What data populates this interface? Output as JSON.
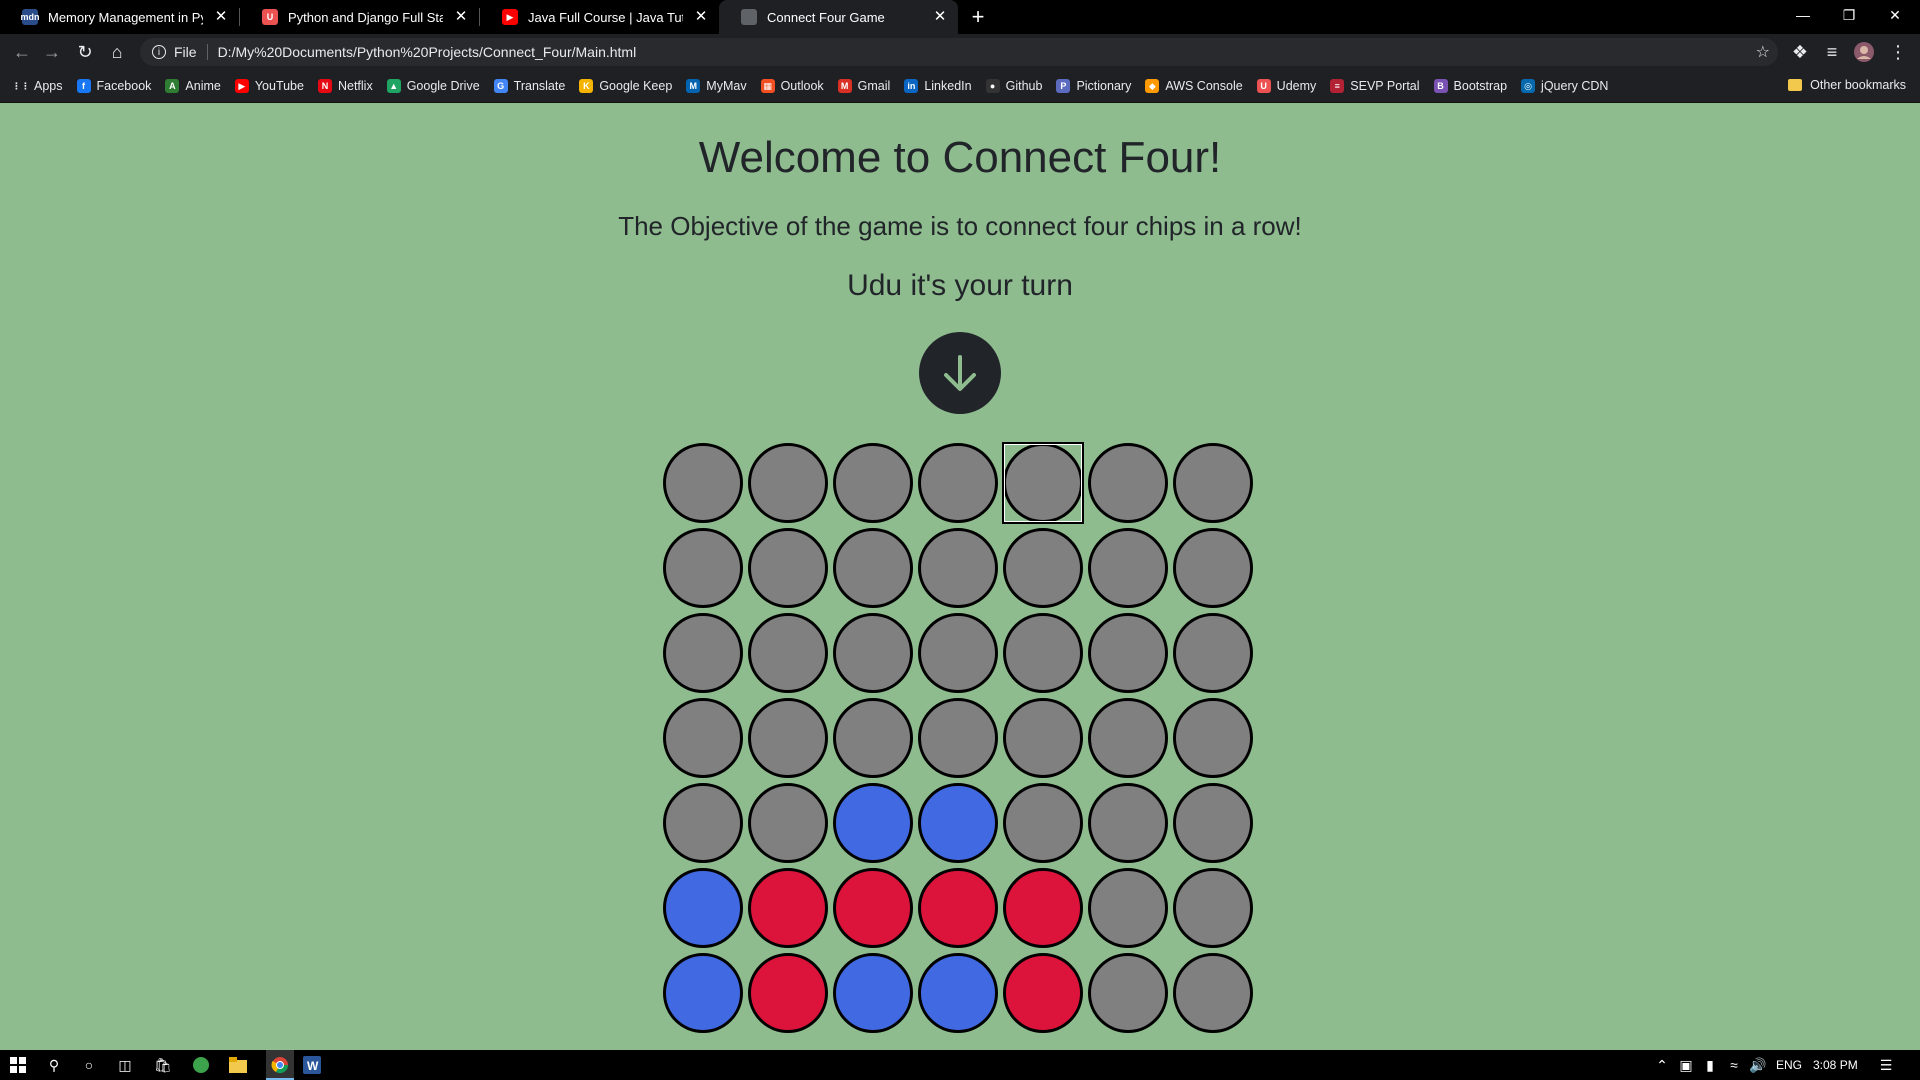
{
  "browser": {
    "tabs": [
      {
        "title": "Memory Management in Python",
        "favicon": "mdn-icon",
        "color": "#2a4c8a",
        "glyph": "mdn",
        "active": false
      },
      {
        "title": "Python and Django Full Stack We",
        "favicon": "udemy-icon",
        "color": "#ec5252",
        "glyph": "U",
        "active": false
      },
      {
        "title": "Java Full Course | Java Tutorial fo",
        "favicon": "youtube-icon",
        "color": "#ff0000",
        "glyph": "▶",
        "active": false
      },
      {
        "title": "Connect Four Game",
        "favicon": "globe-icon",
        "color": "#5f6368",
        "glyph": "",
        "active": true
      }
    ],
    "address": {
      "scheme": "File",
      "url": "D:/My%20Documents/Python%20Projects/Connect_Four/Main.html"
    },
    "bookmarks": [
      {
        "label": "Apps",
        "icon": "apps-grid-icon",
        "color": "#e8eaed",
        "glyph": "⋮⋮"
      },
      {
        "label": "Facebook",
        "icon": "facebook-icon",
        "color": "#1877f2",
        "glyph": "f"
      },
      {
        "label": "Anime",
        "icon": "anime-icon",
        "color": "#2e7d32",
        "glyph": "A"
      },
      {
        "label": "YouTube",
        "icon": "youtube-icon",
        "color": "#ff0000",
        "glyph": "▶"
      },
      {
        "label": "Netflix",
        "icon": "netflix-icon",
        "color": "#e50914",
        "glyph": "N"
      },
      {
        "label": "Google Drive",
        "icon": "google-drive-icon",
        "color": "#1fa463",
        "glyph": "▲"
      },
      {
        "label": "Translate",
        "icon": "translate-icon",
        "color": "#4285f4",
        "glyph": "G"
      },
      {
        "label": "Google Keep",
        "icon": "google-keep-icon",
        "color": "#f4b400",
        "glyph": "K"
      },
      {
        "label": "MyMav",
        "icon": "mymav-icon",
        "color": "#0064b1",
        "glyph": "M"
      },
      {
        "label": "Outlook",
        "icon": "outlook-icon",
        "color": "#f25022",
        "glyph": "▦"
      },
      {
        "label": "Gmail",
        "icon": "gmail-icon",
        "color": "#d93025",
        "glyph": "M"
      },
      {
        "label": "LinkedIn",
        "icon": "linkedin-icon",
        "color": "#0a66c2",
        "glyph": "in"
      },
      {
        "label": "Github",
        "icon": "github-icon",
        "color": "#333333",
        "glyph": "●"
      },
      {
        "label": "Pictionary",
        "icon": "pictionary-icon",
        "color": "#5c6bc0",
        "glyph": "P"
      },
      {
        "label": "AWS Console",
        "icon": "aws-icon",
        "color": "#ff9900",
        "glyph": "◆"
      },
      {
        "label": "Udemy",
        "icon": "udemy-icon",
        "color": "#ec5252",
        "glyph": "U"
      },
      {
        "label": "SEVP Portal",
        "icon": "us-flag-icon",
        "color": "#b22234",
        "glyph": "≡"
      },
      {
        "label": "Bootstrap",
        "icon": "bootstrap-icon",
        "color": "#7952b3",
        "glyph": "B"
      },
      {
        "label": "jQuery CDN",
        "icon": "jquery-icon",
        "color": "#0769ad",
        "glyph": "◎"
      }
    ],
    "other_bookmarks": "Other bookmarks"
  },
  "game": {
    "title": "Welcome to Connect Four!",
    "objective": "The Objective of the game is to connect four chips in a row!",
    "turn_text": "Udu it's your turn",
    "colors": {
      "empty": "#808080",
      "blue": "#4169e1",
      "red": "#dc143c",
      "page_bg": "#8fbc8f"
    },
    "focused_cell": [
      0,
      4
    ],
    "board": [
      [
        "empty",
        "empty",
        "empty",
        "empty",
        "empty",
        "empty",
        "empty"
      ],
      [
        "empty",
        "empty",
        "empty",
        "empty",
        "empty",
        "empty",
        "empty"
      ],
      [
        "empty",
        "empty",
        "empty",
        "empty",
        "empty",
        "empty",
        "empty"
      ],
      [
        "empty",
        "empty",
        "empty",
        "empty",
        "empty",
        "empty",
        "empty"
      ],
      [
        "empty",
        "empty",
        "blue",
        "blue",
        "empty",
        "empty",
        "empty"
      ],
      [
        "blue",
        "red",
        "red",
        "red",
        "red",
        "empty",
        "empty"
      ],
      [
        "blue",
        "red",
        "blue",
        "blue",
        "red",
        "empty",
        "empty"
      ]
    ]
  },
  "taskbar": {
    "language": "ENG",
    "time": "3:08 PM"
  }
}
